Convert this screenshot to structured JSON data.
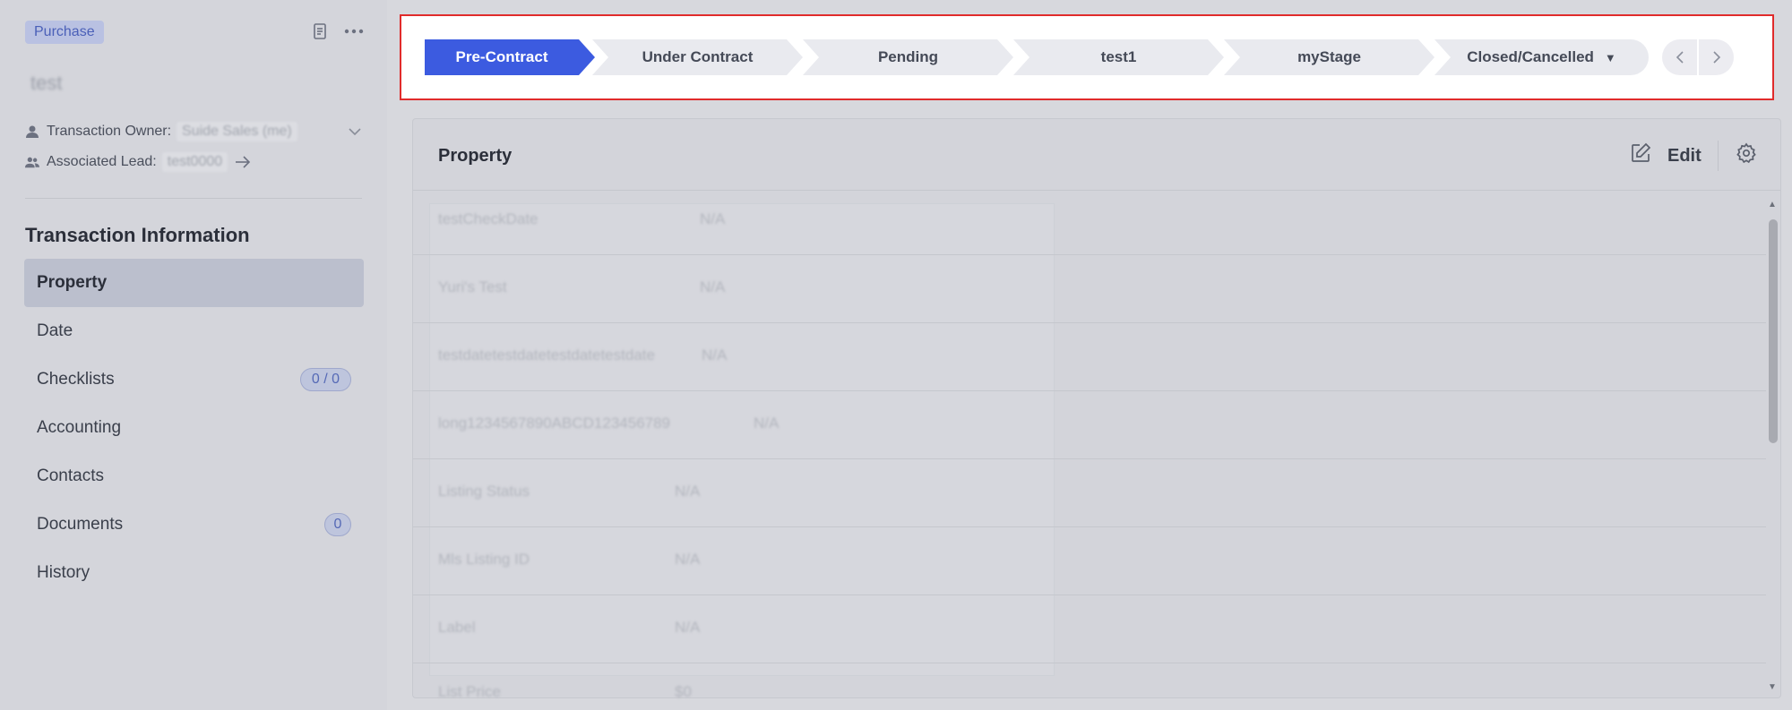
{
  "sidebar": {
    "tag": "Purchase",
    "title": "test",
    "owner_label": "Transaction Owner:",
    "owner_value": "Suide Sales  (me)",
    "lead_label": "Associated Lead:",
    "lead_value": "test0000",
    "section_title": "Transaction Information",
    "items": [
      {
        "label": "Property",
        "badge": ""
      },
      {
        "label": "Date",
        "badge": ""
      },
      {
        "label": "Checklists",
        "badge": "0 / 0"
      },
      {
        "label": "Accounting",
        "badge": ""
      },
      {
        "label": "Contacts",
        "badge": ""
      },
      {
        "label": "Documents",
        "badge": "0"
      },
      {
        "label": "History",
        "badge": ""
      }
    ]
  },
  "stages": {
    "items": [
      "Pre-Contract",
      "Under Contract",
      "Pending",
      "test1",
      "myStage",
      "Closed/Cancelled"
    ],
    "active": "Pre-Contract",
    "active_color": "#3c5be0",
    "prev_icon": "chevron-left-icon",
    "next_icon": "chevron-right-icon"
  },
  "panel": {
    "title": "Property",
    "edit_label": "Edit",
    "rows": [
      {
        "label": "testCheckDate",
        "value": "N/A"
      },
      {
        "label": "Yuri's Test",
        "value": "N/A"
      },
      {
        "label": "testdatetestdatetestdatetestdate",
        "value": "N/A"
      },
      {
        "label": "long1234567890ABCD123456789",
        "value": "N/A"
      },
      {
        "label": "Listing Status",
        "value": "N/A"
      },
      {
        "label": "Mls Listing ID",
        "value": "N/A"
      },
      {
        "label": "Label",
        "value": "N/A"
      },
      {
        "label": "List Price",
        "value": "$0"
      }
    ]
  },
  "colors": {
    "highlight_frame": "#e02b2b",
    "accent": "#3c5be0"
  }
}
